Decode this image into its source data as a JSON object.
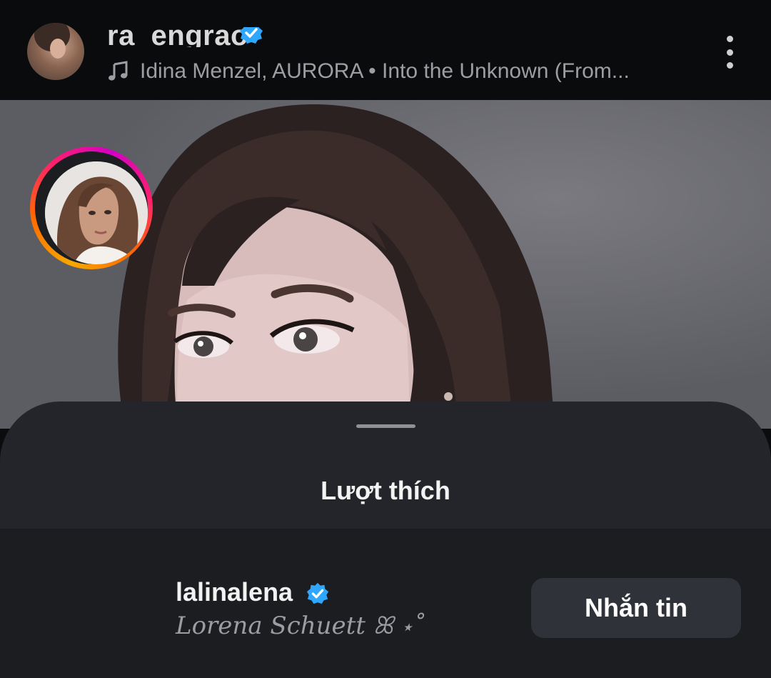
{
  "post_header": {
    "username": "ra_engrao",
    "music_text": "Idina Menzel, AURORA • Into the Unknown (From..."
  },
  "likes_sheet": {
    "title": "Lượt thích",
    "users": [
      {
        "username": "lalinalena",
        "full_name": "Lorena Schuett ꕤ ⋆˚",
        "verified": true,
        "action_label": "Nhắn tin"
      }
    ]
  },
  "colors": {
    "verified_badge": "#2fa7ff",
    "sheet_background": "#23252a",
    "button_background": "#2f3238"
  }
}
